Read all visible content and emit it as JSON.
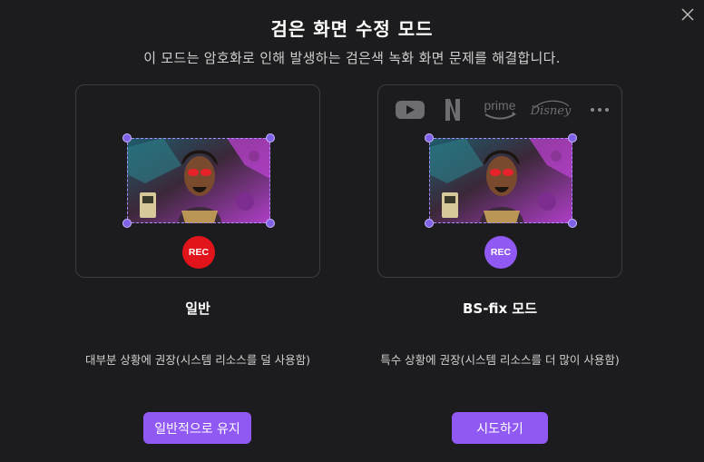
{
  "dialog": {
    "title": "검은 화면 수정 모드",
    "subtitle": "이 모드는 암호화로 인해 발생하는 검은색 녹화 화면 문제를 해결합니다.",
    "close_icon": "close-icon"
  },
  "modes": [
    {
      "name": "일반",
      "description": "대부분 상황에 권장(시스템 리소스를 덜 사용함)",
      "rec_label": "REC",
      "rec_color": "#e1141c",
      "button_label": "일반적으로 유지"
    },
    {
      "name": "BS-fix 모드",
      "description": "특수 상황에 권장(시스템 리소스를 더 많이 사용함)",
      "rec_label": "REC",
      "rec_color": "#9159f3",
      "button_label": "시도하기",
      "streaming_services": {
        "prime_label": "prime",
        "disney_label": "Disney",
        "icons": [
          "youtube-icon",
          "netflix-icon",
          "prime-video-icon",
          "disney-icon",
          "more-icon"
        ]
      }
    }
  ],
  "colors": {
    "accent": "#9159f3",
    "background": "#1c1c1e",
    "card_border": "#3d3d40",
    "selection": "#a98cff"
  }
}
